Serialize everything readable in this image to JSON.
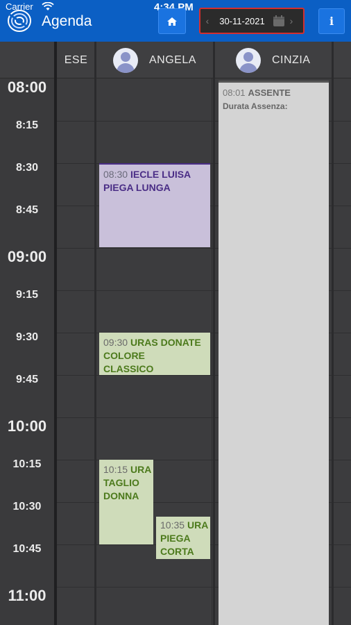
{
  "status": {
    "carrier": "Carrier",
    "time": "4:34 PM"
  },
  "header": {
    "title": "Agenda",
    "date": "30-11-2021",
    "info_label": "i"
  },
  "columns": [
    {
      "name": "ESE"
    },
    {
      "name": "ANGELA"
    },
    {
      "name": "CINZIA"
    }
  ],
  "time_slots": [
    {
      "label": "08:00",
      "kind": "hour"
    },
    {
      "label": "8:15",
      "kind": "quarter"
    },
    {
      "label": "8:30",
      "kind": "quarter"
    },
    {
      "label": "8:45",
      "kind": "quarter"
    },
    {
      "label": "09:00",
      "kind": "hour"
    },
    {
      "label": "9:15",
      "kind": "quarter"
    },
    {
      "label": "9:30",
      "kind": "quarter"
    },
    {
      "label": "9:45",
      "kind": "quarter"
    },
    {
      "label": "10:00",
      "kind": "hour"
    },
    {
      "label": "10:15",
      "kind": "quarter"
    },
    {
      "label": "10:30",
      "kind": "quarter"
    },
    {
      "label": "10:45",
      "kind": "quarter"
    },
    {
      "label": "11:00",
      "kind": "hour"
    }
  ],
  "events": [
    {
      "time": "08:30",
      "client": "IECLE LUISA",
      "service": "PIEGA LUNGA",
      "style": "purple"
    },
    {
      "time": "09:30",
      "client": "URAS DONATE",
      "service": "COLORE CLASSICO",
      "style": "green"
    },
    {
      "time": "10:15",
      "client": "URA",
      "service": "TAGLIO DONNA",
      "style": "green"
    },
    {
      "time": "10:35",
      "client": "URA",
      "service": "PIEGA CORTA",
      "style": "green"
    },
    {
      "time": "08:01",
      "client": "ASSENTE",
      "service": "Durata Assenza:",
      "style": "gray"
    }
  ],
  "colors": {
    "header": "#0b5fc4",
    "date_border": "#d32f2f",
    "event_purple": "#c9c0da",
    "event_green": "#cfdcba",
    "absence": "#d4d4d4"
  }
}
